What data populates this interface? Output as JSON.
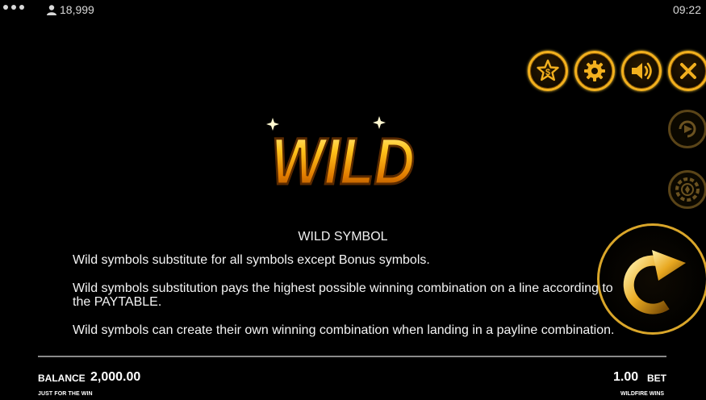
{
  "topbar": {
    "balance_count": "18,999",
    "time": "09:22"
  },
  "icons": {
    "menu": "menu-dots-icon",
    "user": "user-icon",
    "paytable": "star-dollar-icon",
    "settings": "gear-icon",
    "sound": "speaker-icon",
    "close": "close-icon",
    "autoplay": "autoplay-icon",
    "bet": "chip-icon",
    "spin": "spin-arrow-icon"
  },
  "colors": {
    "gold": "#f2b01e",
    "background": "#000000",
    "text": "#f4f4f4"
  },
  "logo": {
    "text": "WILD"
  },
  "content": {
    "heading": "WILD SYMBOL",
    "paragraphs": [
      "Wild symbols substitute for all symbols except Bonus symbols.",
      "Wild symbols substitution pays the highest possible winning combination on a line according to the PAYTABLE.",
      "Wild symbols can create their own winning combination when landing in a payline combination."
    ]
  },
  "footer": {
    "balance_label": "BALANCE",
    "balance_value": "2,000.00",
    "left_caption": "JUST FOR THE WIN",
    "bet_value": "1.00",
    "bet_label": "BET",
    "right_caption": "WILDFIRE WINS"
  }
}
